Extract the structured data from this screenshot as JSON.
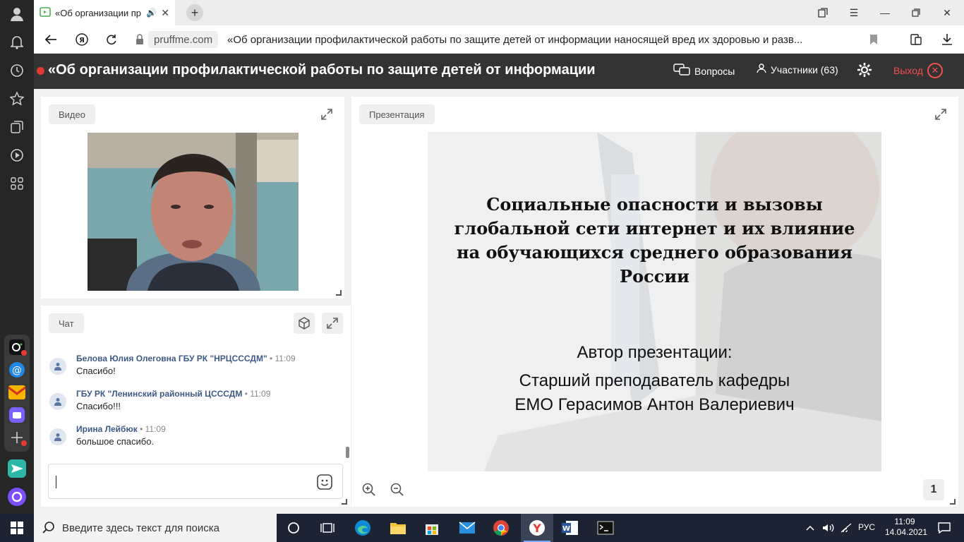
{
  "browser": {
    "tab_title": "«Об организации пр",
    "new_tab": "+",
    "url_domain": "pruffme.com",
    "url_title": "«Об организации профилактической работы по защите детей от информации наносящей вред их здоровью и разв..."
  },
  "header": {
    "title": "«Об организации профилактической работы по защите детей от информации",
    "questions_label": "Вопросы",
    "participants_label": "Участники (63)",
    "exit_label": "Выход"
  },
  "video_panel": {
    "label": "Видео"
  },
  "chat_panel": {
    "label": "Чат",
    "messages": [
      {
        "author": "Белова Юлия Олеговна ГБУ РК \"НРЦСССДМ\"",
        "time": "• 11:09",
        "text": "Спасибо!"
      },
      {
        "author": "ГБУ РК \"Ленинский районный ЦСССДМ",
        "time": "• 11:09",
        "text": "Спасибо!!!"
      },
      {
        "author": "Ирина Лейбюк",
        "time": "• 11:09",
        "text": "большое спасибо."
      }
    ],
    "input_value": ""
  },
  "presentation_panel": {
    "label": "Презентация",
    "slide_title_lines": [
      "Социальные опасности и вызовы",
      "глобальной сети интернет и их влияние",
      "на обучающихся среднего образования",
      "России"
    ],
    "author_heading": "Автор презентации:",
    "author_lines": [
      "Старший преподаватель кафедры",
      "ЕМО Герасимов Антон Валериевич"
    ],
    "page_number": "1"
  },
  "taskbar": {
    "search_placeholder": "Введите здесь текст для поиска",
    "language": "РУС",
    "time": "11:09",
    "date": "14.04.2021"
  },
  "colors": {
    "header_bg": "#333333",
    "accent_red": "#e53935",
    "author_blue": "#3d5a86"
  }
}
